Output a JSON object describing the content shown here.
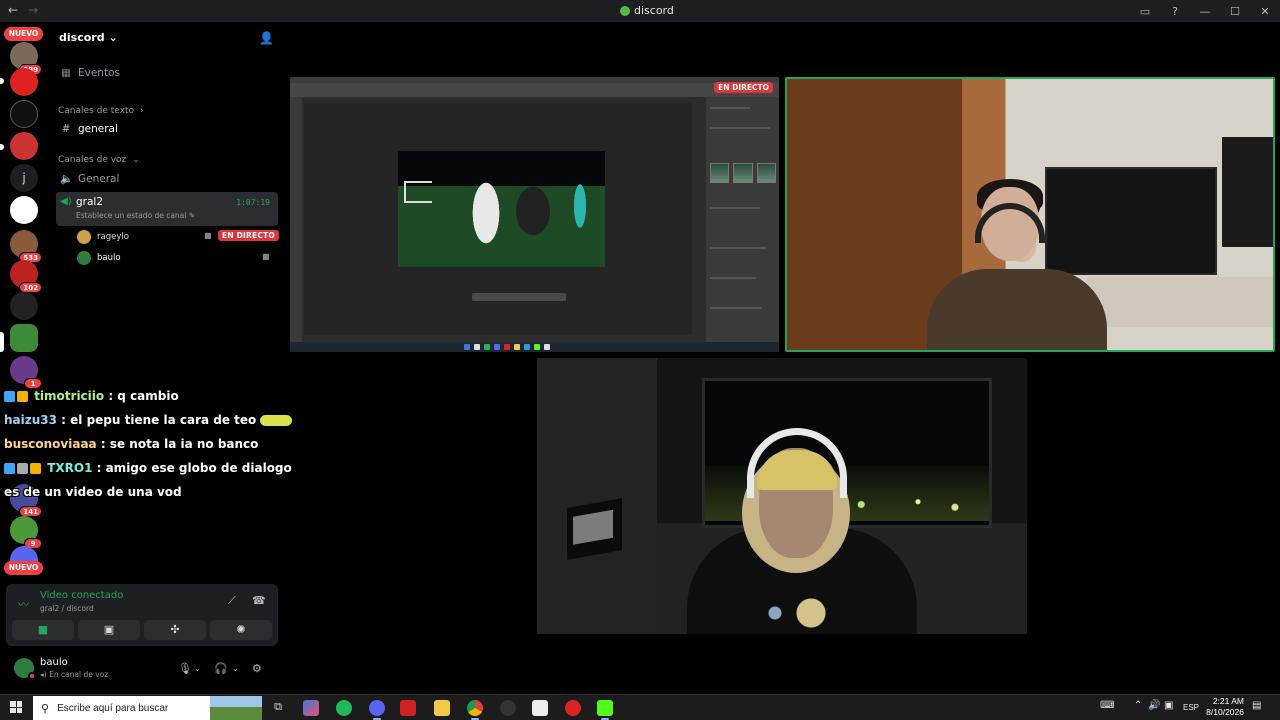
{
  "titlebar": {
    "app_title": "discord",
    "back": "←",
    "forward": "→"
  },
  "rail": {
    "nuevo_top": "NUEVO",
    "nuevo_bottom": "NUEVO",
    "badges": [
      "399",
      "533",
      "102",
      "1",
      "141",
      "9"
    ],
    "home_letter": "j"
  },
  "sidebar": {
    "server_name": "discord",
    "events": "Eventos",
    "text_category": "Canales de texto",
    "text_channel": "general",
    "voice_category": "Canales de voz",
    "voice_channel_1": "General",
    "voice_channel_2": "gral2",
    "voice_status_placeholder": "Establece un estado de canal",
    "elapsed": "1:07:19",
    "members": [
      {
        "name": "rageylo",
        "live": "EN DIRECTO"
      },
      {
        "name": "baulo"
      }
    ]
  },
  "chat": [
    {
      "user": "timotriciio",
      "text": ": q cambio"
    },
    {
      "user": "haizu33",
      "text": ": el pepu tiene la cara de teo"
    },
    {
      "user": "busconoviaaa",
      "text": ": se nota la ia no banco"
    },
    {
      "user": "TXRO1",
      "text": ": amigo ese globo de dialogo es de un video de una vod"
    }
  ],
  "voice_panel": {
    "status": "Video conectado",
    "location": "gral2 / discord"
  },
  "user_panel": {
    "username": "baulo",
    "status": "En canal de voz"
  },
  "stage": {
    "live_label": "EN DIRECTO"
  },
  "taskbar": {
    "search_placeholder": "Escribe aquí para buscar",
    "language": "ESP",
    "time": "2:21 AM",
    "date": "8/10/2026"
  },
  "colors": {
    "accent_green": "#23a55a",
    "live_red": "#da373c",
    "badge_red": "#f23f42",
    "sidebar_bg": "#000000",
    "panel_bg": "#1e1f22"
  },
  "icons": {
    "events": "calendar-icon",
    "text_channel": "hash-icon",
    "voice_channel": "speaker-icon",
    "camera": "camera-icon",
    "screen_share": "screen-share-icon",
    "activities": "activities-icon",
    "soundboard": "soundboard-icon",
    "mic": "microphone-icon",
    "headset": "headset-icon",
    "settings": "gear-icon"
  }
}
